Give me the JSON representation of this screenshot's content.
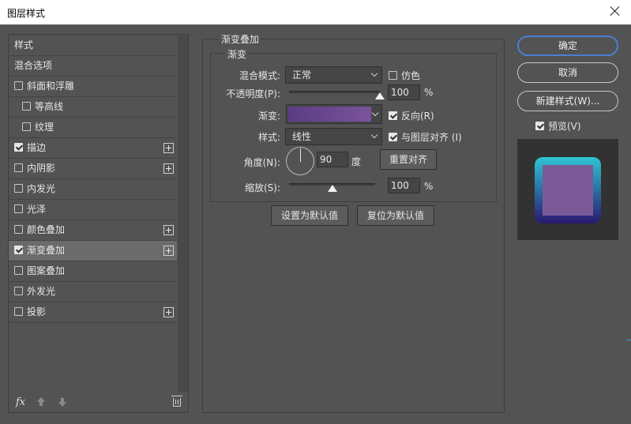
{
  "window": {
    "title": "图层样式"
  },
  "left_panel": {
    "items": [
      {
        "label": "样式",
        "checkbox": false,
        "checked": false,
        "plus": false,
        "indent": false,
        "selected": false
      },
      {
        "label": "混合选项",
        "checkbox": false,
        "checked": false,
        "plus": false,
        "indent": false,
        "selected": false
      },
      {
        "label": "斜面和浮雕",
        "checkbox": true,
        "checked": false,
        "plus": false,
        "indent": false,
        "selected": false
      },
      {
        "label": "等高线",
        "checkbox": true,
        "checked": false,
        "plus": false,
        "indent": true,
        "selected": false
      },
      {
        "label": "纹理",
        "checkbox": true,
        "checked": false,
        "plus": false,
        "indent": true,
        "selected": false
      },
      {
        "label": "描边",
        "checkbox": true,
        "checked": true,
        "plus": true,
        "indent": false,
        "selected": false
      },
      {
        "label": "内阴影",
        "checkbox": true,
        "checked": false,
        "plus": true,
        "indent": false,
        "selected": false
      },
      {
        "label": "内发光",
        "checkbox": true,
        "checked": false,
        "plus": false,
        "indent": false,
        "selected": false
      },
      {
        "label": "光泽",
        "checkbox": true,
        "checked": false,
        "plus": false,
        "indent": false,
        "selected": false
      },
      {
        "label": "颜色叠加",
        "checkbox": true,
        "checked": false,
        "plus": true,
        "indent": false,
        "selected": false
      },
      {
        "label": "渐变叠加",
        "checkbox": true,
        "checked": true,
        "plus": true,
        "indent": false,
        "selected": true
      },
      {
        "label": "图案叠加",
        "checkbox": true,
        "checked": false,
        "plus": false,
        "indent": false,
        "selected": false
      },
      {
        "label": "外发光",
        "checkbox": true,
        "checked": false,
        "plus": false,
        "indent": false,
        "selected": false
      },
      {
        "label": "投影",
        "checkbox": true,
        "checked": false,
        "plus": true,
        "indent": false,
        "selected": false
      }
    ],
    "footer": {
      "fx_label": "fx"
    }
  },
  "gradient_overlay": {
    "group_title": "渐变叠加",
    "sub_title": "渐变",
    "blend_mode_label": "混合模式:",
    "blend_mode_value": "正常",
    "dither_label": "仿色",
    "dither_checked": false,
    "opacity_label": "不透明度(P):",
    "opacity_value": "100",
    "opacity_unit": "%",
    "opacity_level": 1.0,
    "gradient_label": "渐变:",
    "gradient_colors": [
      "#5a3c84",
      "#7a539c"
    ],
    "reverse_label": "反向(R)",
    "reverse_checked": true,
    "style_label": "样式:",
    "style_value": "线性",
    "align_label": "与图层对齐 (I)",
    "align_checked": true,
    "angle_label": "角度(N):",
    "angle_value": "90",
    "angle_unit": "度",
    "reset_align_label": "重置对齐",
    "scale_label": "缩放(S):",
    "scale_value": "100",
    "scale_unit": "%",
    "scale_level": 0.5,
    "make_default_label": "设置为默认值",
    "reset_default_label": "复位为默认值"
  },
  "right_panel": {
    "ok_label": "确定",
    "cancel_label": "取消",
    "new_style_label": "新建样式(W)...",
    "preview_label": "预览(V)",
    "preview_checked": true,
    "preview_colors": {
      "outer_top": "#2ec5d4",
      "outer_bottom": "#2a1870",
      "inner": "#7a5b98",
      "accent": "#4a7fd6"
    }
  }
}
